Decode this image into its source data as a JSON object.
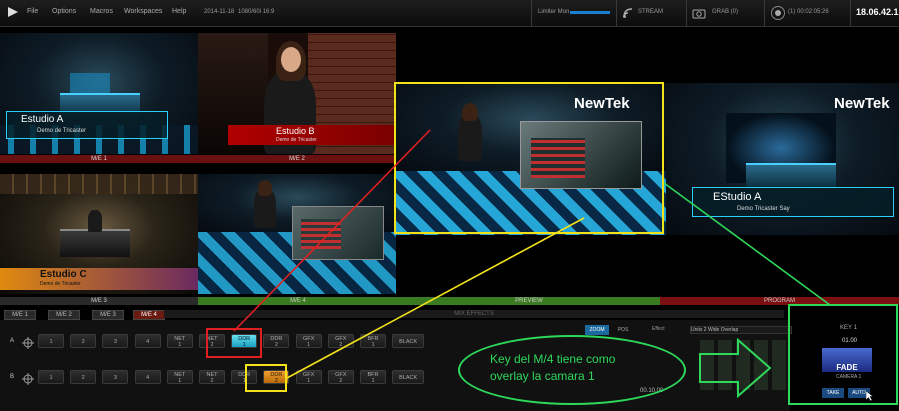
{
  "menu": [
    "File",
    "Options",
    "Macros",
    "Workspaces",
    "Help"
  ],
  "top_info": {
    "date": "2014-11-18",
    "format": "1080/60i 16:9",
    "audio_label": "Limiter Mon",
    "stream_label": "STREAM",
    "grab_label": "GRAB (0)",
    "record_label": "(1) 00:02:05:26",
    "clock": "18.06.42.1"
  },
  "monitors": [
    {
      "id": "m1",
      "title": "Estudio A",
      "subtitle": "Demo de Tricaster",
      "label": "M/E 1"
    },
    {
      "id": "m2",
      "title": "Estudio B",
      "subtitle": "Demo de Tricaster",
      "label": "M/E 2"
    },
    {
      "id": "m3",
      "title": "Estudio C",
      "subtitle": "Demo de Tricaster",
      "label": "M/E 3"
    },
    {
      "id": "m4",
      "title": "",
      "subtitle": "",
      "label": "M/E 4"
    }
  ],
  "preview": {
    "label": "PREVIEW",
    "logo": "NewTek"
  },
  "program": {
    "label": "PROGRAM",
    "logo": "NewTek",
    "title": "EStudio A",
    "subtitle": "Demo Tricaster Say"
  },
  "me_tabs": [
    "M/E 1",
    "M/E 2",
    "M/E 3",
    "M/E 4"
  ],
  "mix_effects_label": "MIX EFFECTS",
  "bus_rows": [
    {
      "name": "A",
      "buttons": [
        {
          "l1": "1",
          "l2": ""
        },
        {
          "l1": "2",
          "l2": ""
        },
        {
          "l1": "3",
          "l2": ""
        },
        {
          "l1": "4",
          "l2": ""
        },
        {
          "l1": "NET",
          "l2": "1"
        },
        {
          "l1": "NET",
          "l2": "2"
        },
        {
          "l1": "DDR",
          "l2": "1"
        },
        {
          "l1": "DDR",
          "l2": "2"
        },
        {
          "l1": "GFX",
          "l2": "1"
        },
        {
          "l1": "GFX",
          "l2": "2"
        },
        {
          "l1": "BFR",
          "l2": "1"
        },
        {
          "l1": "BLACK",
          "l2": ""
        }
      ],
      "active_index": 6,
      "active_color": "cyan"
    },
    {
      "name": "B",
      "buttons": [
        {
          "l1": "1",
          "l2": ""
        },
        {
          "l1": "2",
          "l2": ""
        },
        {
          "l1": "3",
          "l2": ""
        },
        {
          "l1": "4",
          "l2": ""
        },
        {
          "l1": "NET",
          "l2": "1"
        },
        {
          "l1": "NET",
          "l2": "2"
        },
        {
          "l1": "DDR",
          "l2": "1"
        },
        {
          "l1": "DDR",
          "l2": "2"
        },
        {
          "l1": "GFX",
          "l2": "1"
        },
        {
          "l1": "GFX",
          "l2": "2"
        },
        {
          "l1": "BFR",
          "l2": "1"
        },
        {
          "l1": "BLACK",
          "l2": ""
        }
      ],
      "active_index": 7,
      "active_color": "amber"
    }
  ],
  "controls": {
    "zoom_label": "ZOOM",
    "pos_label": "POS",
    "effect_label": "Effect",
    "overlay_name": "Units 2 Wide Overlap",
    "duration": "00.10.00",
    "key_label": "KEY 1",
    "key_value": "01.00",
    "fade_label": "FADE",
    "camera_label": "CAMERA 1",
    "take_label": "TAKE",
    "auto_label": "AUTO"
  },
  "annotation": {
    "line1": "Key del M/4 tiene como",
    "line2": "overlay la camara 1"
  },
  "colors": {
    "red": "#e02020",
    "yellow": "#f2e21a",
    "green": "#2ed85a",
    "cyan": "#1ab0e8",
    "amber": "#f0a030"
  }
}
